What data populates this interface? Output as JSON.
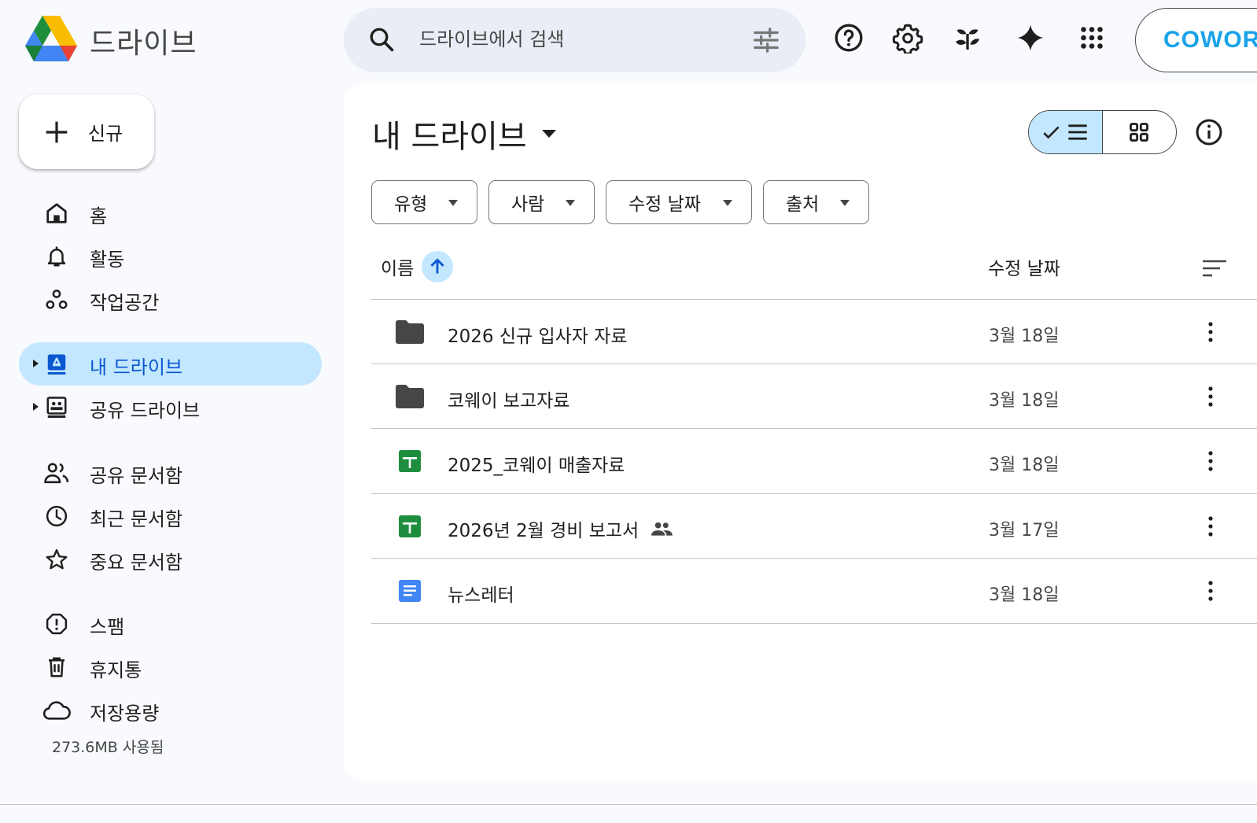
{
  "app": {
    "title": "드라이브"
  },
  "search": {
    "placeholder": "드라이브에서 검색"
  },
  "account": {
    "workspace_label": "COWORK"
  },
  "new_button": {
    "label": "신규"
  },
  "sidebar": {
    "items": [
      {
        "label": "홈",
        "icon": "home-icon"
      },
      {
        "label": "활동",
        "icon": "bell-icon"
      },
      {
        "label": "작업공간",
        "icon": "workspaces-icon"
      },
      {
        "label": "내 드라이브",
        "icon": "my-drive-icon",
        "active": true
      },
      {
        "label": "공유 드라이브",
        "icon": "shared-drive-icon"
      },
      {
        "label": "공유 문서함",
        "icon": "people-icon"
      },
      {
        "label": "최근 문서함",
        "icon": "clock-icon"
      },
      {
        "label": "중요 문서함",
        "icon": "star-icon"
      },
      {
        "label": "스팸",
        "icon": "spam-icon"
      },
      {
        "label": "휴지통",
        "icon": "trash-icon"
      },
      {
        "label": "저장용량",
        "icon": "cloud-icon"
      }
    ],
    "storage_used": "273.6MB 사용됨"
  },
  "main": {
    "title": "내 드라이브",
    "filters": [
      "유형",
      "사람",
      "수정 날짜",
      "출처"
    ],
    "columns": {
      "name": "이름",
      "modified": "수정 날짜"
    },
    "files": [
      {
        "name": "2026 신규 입사자 자료",
        "type": "folder",
        "modified": "3월 18일",
        "shared": false
      },
      {
        "name": "코웨이 보고자료",
        "type": "folder",
        "modified": "3월 18일",
        "shared": false
      },
      {
        "name": "2025_코웨이 매출자료",
        "type": "sheet",
        "modified": "3월 18일",
        "shared": false
      },
      {
        "name": "2026년 2월 경비 보고서",
        "type": "sheet",
        "modified": "3월 17일",
        "shared": true
      },
      {
        "name": "뉴스레터",
        "type": "doc",
        "modified": "3월 18일",
        "shared": false
      }
    ]
  },
  "colors": {
    "accent_light": "#c2e7ff",
    "sheet_green": "#1e8e3e",
    "doc_blue": "#4285f4",
    "brand_cyan": "#1aa3e8"
  }
}
